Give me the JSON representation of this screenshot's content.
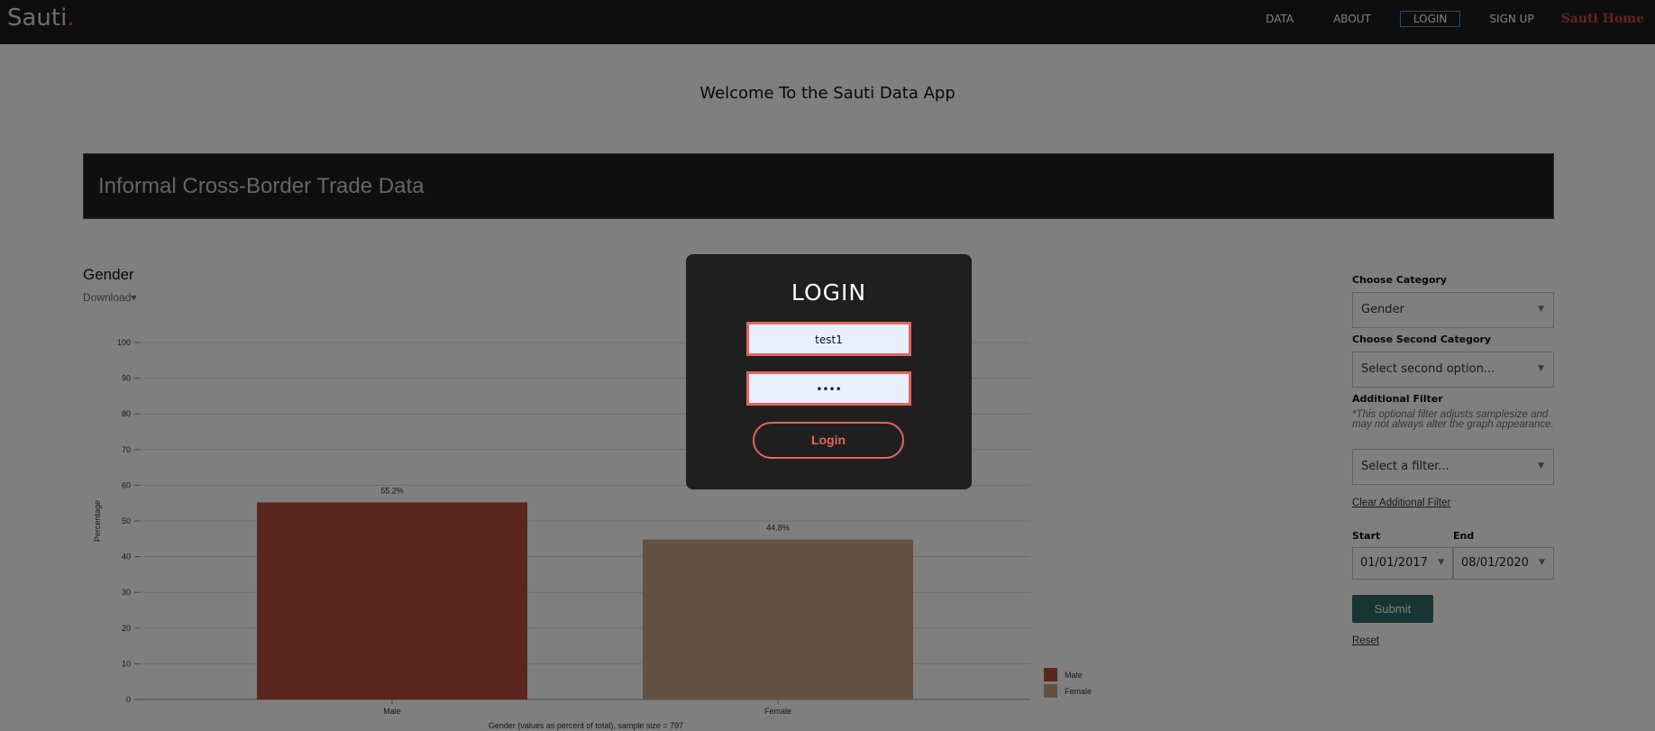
{
  "nav": {
    "brand": "Sauti",
    "brand_dot": ".",
    "links": [
      "DATA",
      "ABOUT",
      "LOGIN",
      "SIGN UP"
    ],
    "home": "Sauti Home"
  },
  "welcome": "Welcome To the Sauti Data App",
  "banner": {
    "title": "Informal Cross-Border Trade Data"
  },
  "chart_section": {
    "title": "Gender",
    "download": "Download▾"
  },
  "chart_data": {
    "type": "bar",
    "categories": [
      "Male",
      "Female"
    ],
    "values": [
      55.2,
      44.8
    ],
    "data_labels": [
      "55.2%",
      "44.8%"
    ],
    "ylabel": "Percentage",
    "xlabel": "Gender (values as percent of total), sample size = 797",
    "ylim": [
      0,
      100
    ],
    "yticks": [
      0,
      10,
      20,
      30,
      40,
      50,
      60,
      70,
      80,
      90,
      100
    ],
    "grid": true,
    "colors": [
      "#b44d3c",
      "#c8a282"
    ],
    "legend": [
      "Male",
      "Female"
    ],
    "legend_position": "bottom-right"
  },
  "sidebar": {
    "category_label": "Choose Category",
    "category_value": "Gender",
    "second_label": "Choose Second Category",
    "second_placeholder": "Select second option...",
    "filter_label": "Additional Filter",
    "filter_note": "*This optional filter adjusts samplesize and may not always alter the graph appearance.",
    "filter_placeholder": "Select a filter...",
    "clear_filter": "Clear Additional Filter",
    "start_label": "Start",
    "start_value": "01/01/2017",
    "end_label": "End",
    "end_value": "08/01/2020",
    "submit": "Submit",
    "reset": "Reset"
  },
  "modal": {
    "title": "LOGIN",
    "username_value": "test1",
    "password_value": "••••",
    "button": "Login"
  },
  "colors": {
    "navbar": "#1c1c1c",
    "accent": "#e0665c",
    "submit": "#2e6b62",
    "modal_bg": "#1f1f1f"
  }
}
